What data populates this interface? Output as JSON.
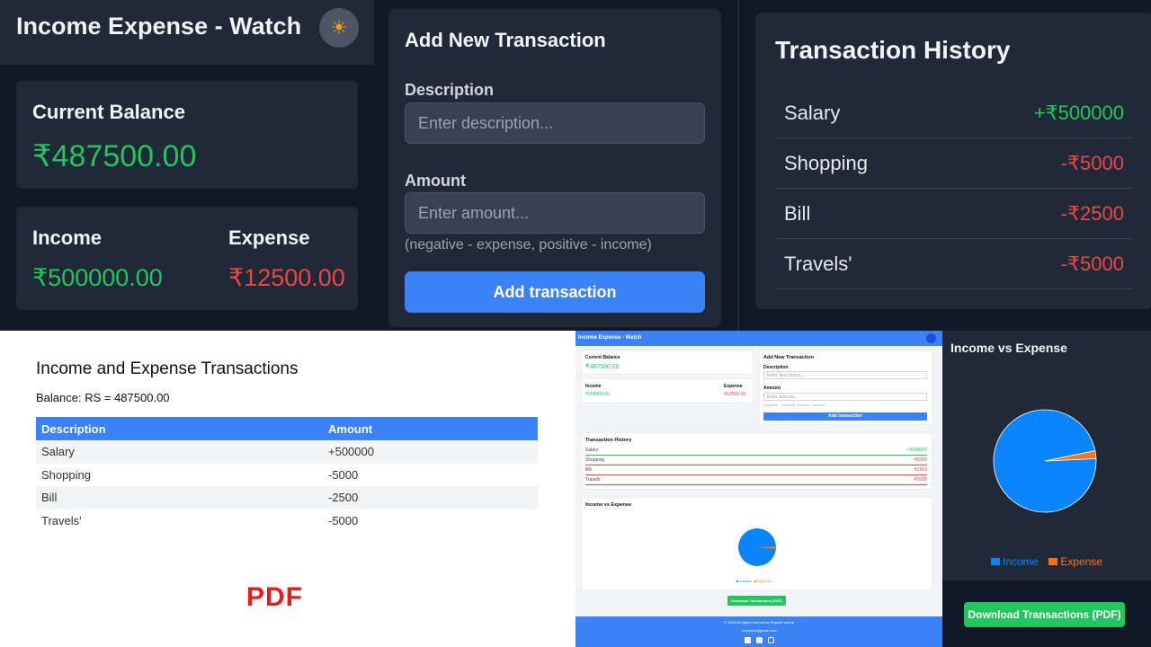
{
  "app": {
    "title": "Income Expense - Watch",
    "theme_icon": "sun-icon"
  },
  "balance": {
    "label": "Current Balance",
    "value": "₹487500.00"
  },
  "income": {
    "label": "Income",
    "value": "₹500000.00"
  },
  "expense": {
    "label": "Expense",
    "value": "₹12500.00"
  },
  "form": {
    "title": "Add New Transaction",
    "description_label": "Description",
    "description_placeholder": "Enter description...",
    "amount_label": "Amount",
    "amount_placeholder": "Enter amount...",
    "hint": "(negative - expense, positive - income)",
    "submit_label": "Add transaction"
  },
  "history": {
    "title": "Transaction History",
    "rows": [
      {
        "desc": "Salary",
        "amount": "+₹500000",
        "type": "income"
      },
      {
        "desc": "Shopping",
        "amount": "-₹5000",
        "type": "expense"
      },
      {
        "desc": "Bill",
        "amount": "-₹2500",
        "type": "expense"
      },
      {
        "desc": "Travels'",
        "amount": "-₹5000",
        "type": "expense"
      }
    ]
  },
  "pdf": {
    "title": "Income and Expense Transactions",
    "balance_line": "Balance: RS = 487500.00",
    "columns": [
      "Description",
      "Amount"
    ],
    "rows": [
      {
        "desc": "Salary",
        "amount": "+500000"
      },
      {
        "desc": "Shopping",
        "amount": "-5000"
      },
      {
        "desc": "Bill",
        "amount": "-2500"
      },
      {
        "desc": "Travels'",
        "amount": "-5000"
      }
    ],
    "logo": "PDF"
  },
  "mini": {
    "title": "Income Expense - Watch",
    "balance_label": "Current Balance",
    "balance_value": "₹487500.00",
    "income_label": "Income",
    "income_value": "₹500000.00",
    "expense_label": "Expense",
    "expense_value": "₹12500.00",
    "form_title": "Add New Transaction",
    "desc_label": "Description",
    "desc_placeholder": "Enter description...",
    "amount_label": "Amount",
    "amount_placeholder": "Enter amount...",
    "hint": "(negative - expense, positive - income)",
    "submit_label": "Add transaction",
    "history_title": "Transaction History",
    "rows": [
      {
        "desc": "Salary",
        "amount": "+₹500000"
      },
      {
        "desc": "Shopping",
        "amount": "-₹5000"
      },
      {
        "desc": "Bill",
        "amount": "-₹2500"
      },
      {
        "desc": "Travels'",
        "amount": "-₹5000"
      }
    ],
    "chart_title": "Income vs Expense",
    "legend_income": "Income",
    "legend_expense": "Expense",
    "download_label": "Download Transactions (PDF)",
    "footer_line1": "© 2025 All rights reserved to Rupesh Verma",
    "footer_line2": "erupeshd@gmail.com",
    "footer_icons": [
      "linkedin-icon",
      "youtube-icon",
      "instagram-icon"
    ]
  },
  "chart": {
    "title": "Income vs Expense",
    "download_label": "Download Transactions (PDF)"
  },
  "chart_data": {
    "type": "pie",
    "categories": [
      "Income",
      "Expense"
    ],
    "values": [
      500000,
      12500
    ],
    "colors": [
      "#0a84ff",
      "#f97316"
    ],
    "title": "Income vs Expense",
    "legend": "bottom"
  },
  "colors": {
    "income": "#22c55e",
    "expense": "#ef4444",
    "accent": "#3b82f6",
    "bg": "#111827",
    "card": "#1f2937"
  }
}
